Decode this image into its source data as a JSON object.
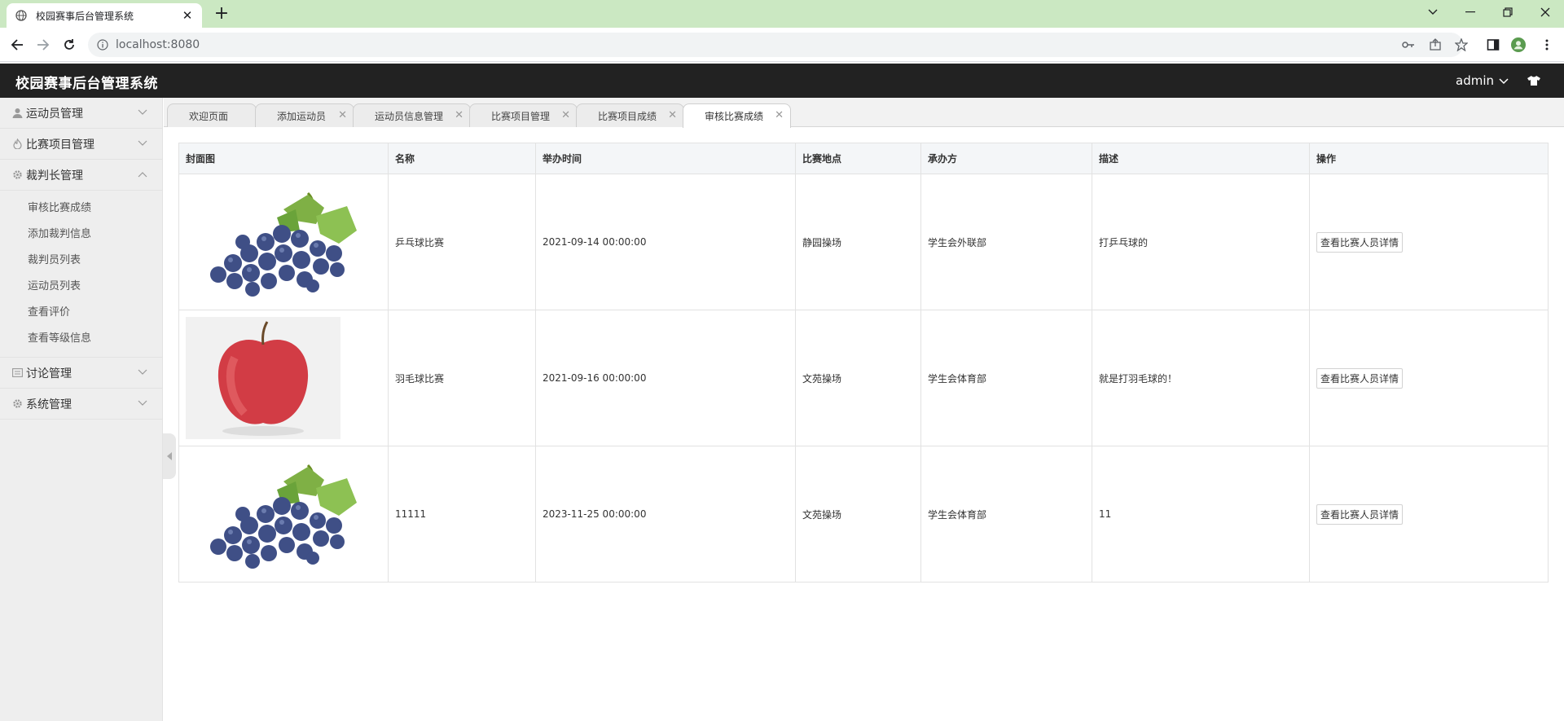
{
  "browser": {
    "tab_title": "校园赛事后台管理系统",
    "url": "localhost:8080"
  },
  "header": {
    "title": "校园赛事后台管理系统",
    "user": "admin"
  },
  "sidebar": {
    "groups": [
      {
        "label": "运动员管理",
        "icon": "user-icon",
        "expanded": false
      },
      {
        "label": "比赛项目管理",
        "icon": "fire-icon",
        "expanded": false
      },
      {
        "label": "裁判长管理",
        "icon": "gear-icon",
        "expanded": true,
        "items": [
          "审核比赛成绩",
          "添加裁判信息",
          "裁判员列表",
          "运动员列表",
          "查看评价",
          "查看等级信息"
        ]
      },
      {
        "label": "讨论管理",
        "icon": "message-icon",
        "expanded": false
      },
      {
        "label": "系统管理",
        "icon": "gear-icon",
        "expanded": false
      }
    ]
  },
  "page_tabs": [
    {
      "label": "欢迎页面",
      "closable": false
    },
    {
      "label": "添加运动员",
      "closable": true
    },
    {
      "label": "运动员信息管理",
      "closable": true
    },
    {
      "label": "比赛项目管理",
      "closable": true
    },
    {
      "label": "比赛项目成绩",
      "closable": true
    },
    {
      "label": "审核比赛成绩",
      "closable": true,
      "active": true
    }
  ],
  "table": {
    "columns": [
      "封面图",
      "名称",
      "举办时间",
      "比赛地点",
      "承办方",
      "描述",
      "操作"
    ],
    "action_label": "查看比赛人员详情",
    "rows": [
      {
        "cover": "grapes",
        "name": "乒乓球比赛",
        "time": "2021-09-14 00:00:00",
        "place": "静园操场",
        "organizer": "学生会外联部",
        "desc": "打乒乓球的"
      },
      {
        "cover": "apple",
        "name": "羽毛球比赛",
        "time": "2021-09-16 00:00:00",
        "place": "文苑操场",
        "organizer": "学生会体育部",
        "desc": "就是打羽毛球的！"
      },
      {
        "cover": "grapes",
        "name": "11111",
        "time": "2023-11-25 00:00:00",
        "place": "文苑操场",
        "organizer": "学生会体育部",
        "desc": "11"
      }
    ]
  }
}
